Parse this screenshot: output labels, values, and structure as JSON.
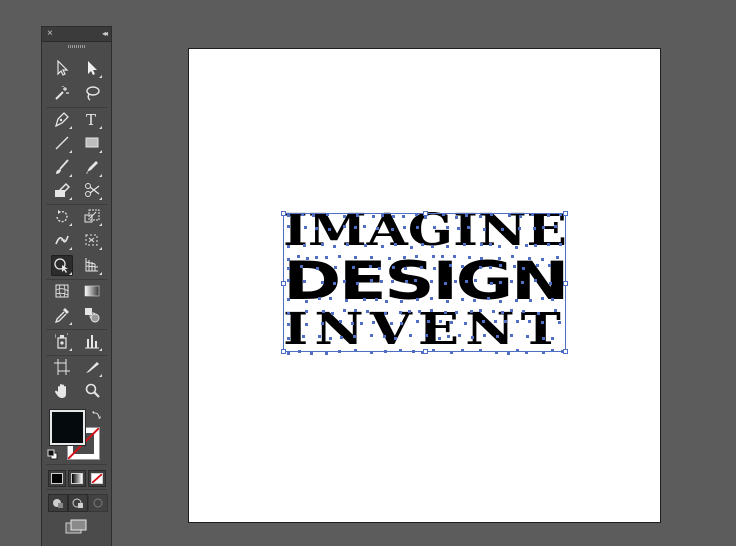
{
  "panel": {
    "close_glyph": "×",
    "collapse_glyph": "◂◂",
    "tools": [
      {
        "name": "selection-tool",
        "icon": "arrow-icon"
      },
      {
        "name": "direct-selection-tool",
        "icon": "direct-arrow-icon"
      },
      {
        "name": "magic-wand-tool",
        "icon": "magic-wand-icon"
      },
      {
        "name": "lasso-tool",
        "icon": "lasso-icon"
      },
      {
        "name": "pen-tool",
        "icon": "pen-icon"
      },
      {
        "name": "type-tool",
        "icon": "type-icon",
        "glyph": "T"
      },
      {
        "name": "line-segment-tool",
        "icon": "line-icon"
      },
      {
        "name": "rectangle-tool",
        "icon": "rectangle-icon"
      },
      {
        "name": "paintbrush-tool",
        "icon": "brush-icon"
      },
      {
        "name": "pencil-tool",
        "icon": "pencil-icon"
      },
      {
        "name": "shaper-tool",
        "icon": "shaper-icon"
      },
      {
        "name": "scissors-tool",
        "icon": "scissors-icon"
      },
      {
        "name": "rotate-tool",
        "icon": "rotate-icon"
      },
      {
        "name": "scale-tool",
        "icon": "scale-icon"
      },
      {
        "name": "width-tool",
        "icon": "width-icon"
      },
      {
        "name": "free-transform-tool",
        "icon": "free-transform-icon"
      },
      {
        "name": "shape-builder-tool",
        "icon": "shape-builder-icon"
      },
      {
        "name": "perspective-grid-tool",
        "icon": "perspective-grid-icon"
      },
      {
        "name": "mesh-tool",
        "icon": "mesh-icon"
      },
      {
        "name": "gradient-tool",
        "icon": "gradient-icon"
      },
      {
        "name": "eyedropper-tool",
        "icon": "eyedropper-icon"
      },
      {
        "name": "blend-tool",
        "icon": "blend-icon"
      },
      {
        "name": "symbol-sprayer-tool",
        "icon": "symbol-sprayer-icon"
      },
      {
        "name": "column-graph-tool",
        "icon": "column-graph-icon"
      },
      {
        "name": "artboard-tool",
        "icon": "artboard-icon"
      },
      {
        "name": "slice-tool",
        "icon": "slice-icon"
      },
      {
        "name": "hand-tool",
        "icon": "hand-icon"
      },
      {
        "name": "zoom-tool",
        "icon": "zoom-icon"
      }
    ],
    "fill_color": "#050a0d",
    "stroke_color": "none"
  },
  "canvas": {
    "background": "#5b5c5b",
    "artboard_color": "#ffffff",
    "selection_color": "#4f6fc4"
  },
  "artwork": {
    "line1": "IMAGINE",
    "line2": "DESIGN",
    "line3": "INVENT"
  }
}
